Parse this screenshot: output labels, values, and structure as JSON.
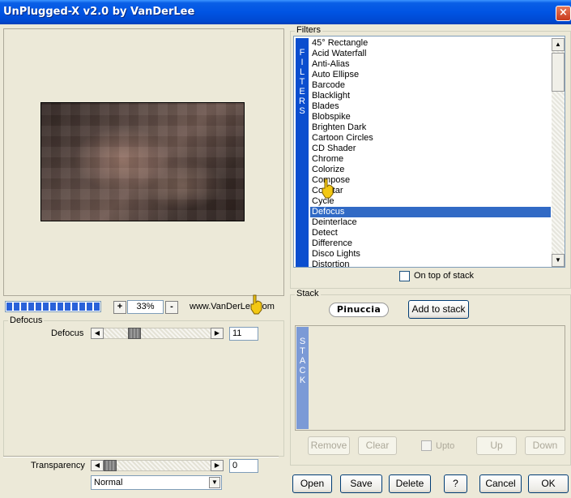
{
  "window": {
    "title": "UnPlugged-X v2.0 by VanDerLee",
    "close_icon": "×"
  },
  "preview": {
    "zoom_minus": "-",
    "zoom_plus": "+",
    "zoom_value": "33%",
    "progress_blocks": 14,
    "website": "www.VanDerLee.com"
  },
  "defocus_group": {
    "label": "Defocus",
    "slider_label": "Defocus",
    "slider_value": "11",
    "arrow_left": "◀",
    "arrow_right": "▶"
  },
  "transparency": {
    "label": "Transparency",
    "value": "0",
    "blend_mode": "Normal",
    "arrow_left": "◀",
    "arrow_right": "▶",
    "dropdown_arrow": "▼"
  },
  "filters": {
    "group_label": "Filters",
    "strip_text": [
      "F",
      "I",
      "L",
      "T",
      "E",
      "R",
      "S"
    ],
    "items": [
      "45° Rectangle",
      "Acid Waterfall",
      "Anti-Alias",
      "Auto Ellipse",
      "Barcode",
      "Blacklight",
      "Blades",
      "Blobspike",
      "Brighten Dark",
      "Cartoon Circles",
      "CD Shader",
      "Chrome",
      "Colorize",
      "Compose",
      "Constar",
      "Cycle",
      "Defocus",
      "Deinterlace",
      "Detect",
      "Difference",
      "Disco Lights",
      "Distortion"
    ],
    "selected": "Defocus",
    "on_top_label": "On top of stack",
    "scroll_up": "▲",
    "scroll_down": "▼"
  },
  "stack": {
    "group_label": "Stack",
    "logo_text": "Pinuccia",
    "add_button": "Add to stack",
    "strip_text": [
      "S",
      "T",
      "A",
      "C",
      "K"
    ],
    "remove_button": "Remove",
    "clear_button": "Clear",
    "upto_label": "Upto",
    "up_button": "Up",
    "down_button": "Down"
  },
  "bottom_buttons": {
    "open": "Open",
    "save": "Save",
    "delete": "Delete",
    "help": "?",
    "cancel": "Cancel",
    "ok": "OK"
  },
  "colors": {
    "selection": "#316ac5",
    "filter_strip": "#0b4ecf",
    "stack_strip": "#7b9ad6",
    "titlebar": "#0054e3"
  }
}
